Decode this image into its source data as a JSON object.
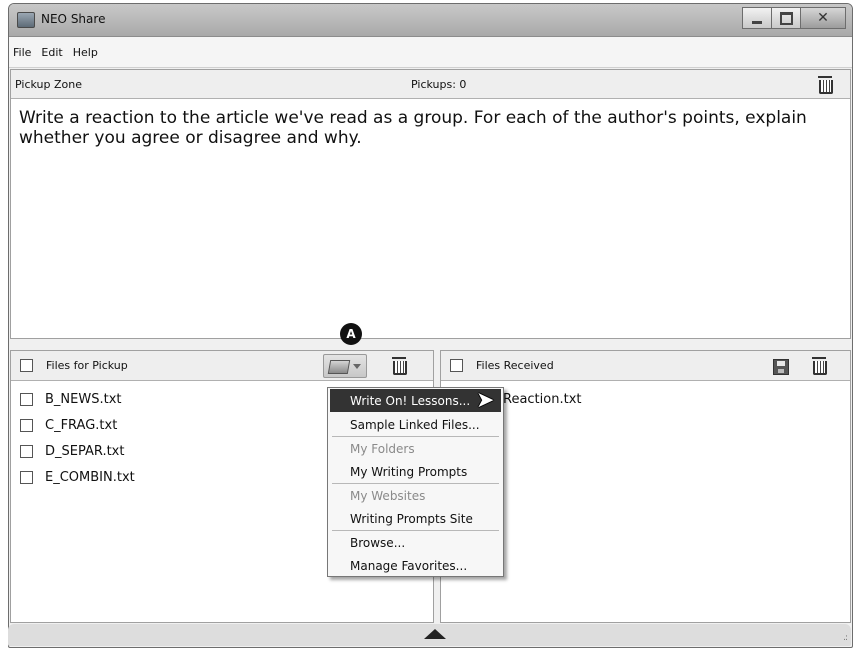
{
  "window": {
    "title": "NEO Share"
  },
  "menu": [
    "File",
    "Edit",
    "Help"
  ],
  "pickup_zone": {
    "label": "Pickup Zone",
    "count_text": "Pickups: 0",
    "prompt": "Write a reaction to the article we've read as a group. For each of the author's points, explain whether you agree or disagree and why."
  },
  "files_for_pickup": {
    "label": "Files for Pickup",
    "files": [
      "B_NEWS.txt",
      "C_FRAG.txt",
      "D_SEPAR.txt",
      "E_COMBIN.txt"
    ]
  },
  "files_received": {
    "label": "Files Received",
    "files": [
      "Reaction.txt"
    ]
  },
  "callout": "A",
  "dropdown": {
    "items": [
      {
        "label": "Write On! Lessons...",
        "type": "active"
      },
      {
        "label": "Sample Linked Files...",
        "type": "item"
      },
      {
        "type": "separator"
      },
      {
        "label": "My Folders",
        "type": "disabled"
      },
      {
        "label": "My Writing Prompts",
        "type": "item"
      },
      {
        "type": "separator"
      },
      {
        "label": "My Websites",
        "type": "disabled"
      },
      {
        "label": "Writing Prompts Site",
        "type": "item"
      },
      {
        "type": "separator"
      },
      {
        "label": "Browse...",
        "type": "item"
      },
      {
        "label": "Manage Favorites...",
        "type": "item"
      }
    ]
  }
}
